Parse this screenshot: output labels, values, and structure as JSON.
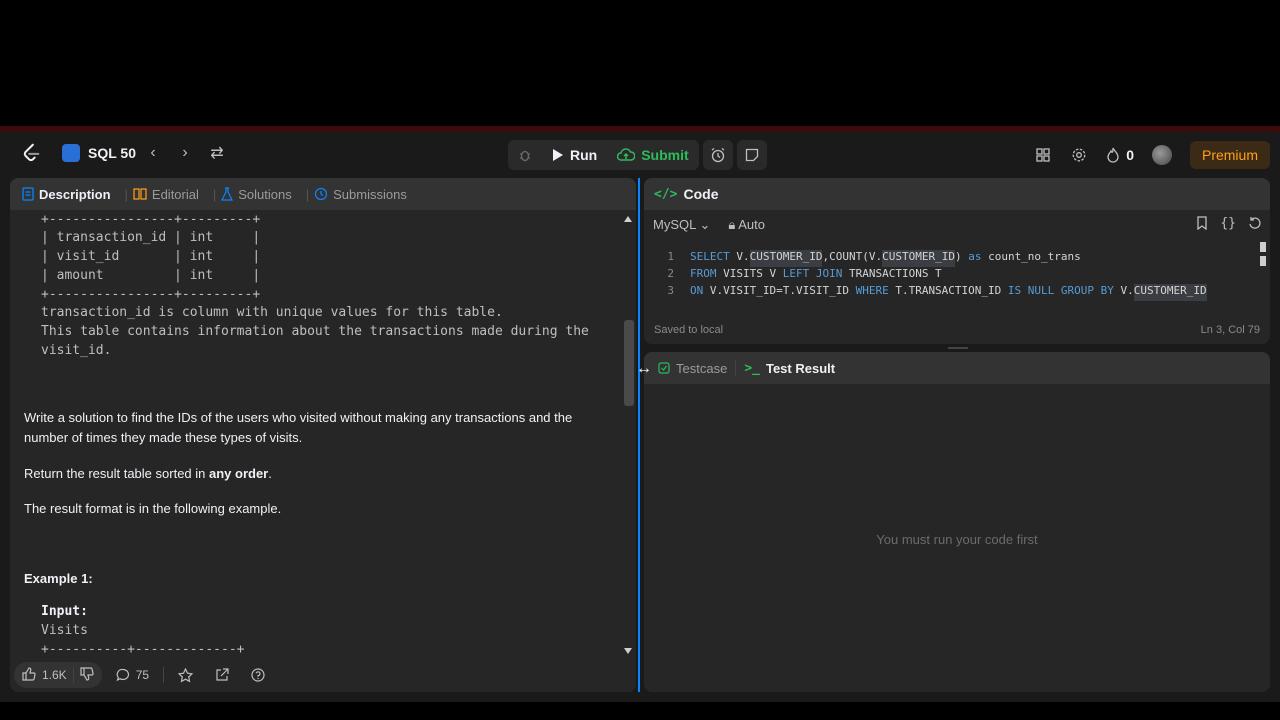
{
  "nav": {
    "brand": "SQL 50",
    "run_label": "Run",
    "submit_label": "Submit",
    "streak_count": "0",
    "premium_label": "Premium"
  },
  "left_tabs": [
    {
      "label": "Description"
    },
    {
      "label": "Editorial"
    },
    {
      "label": "Solutions"
    },
    {
      "label": "Submissions"
    }
  ],
  "description": {
    "table_lines": [
      "+----------------+---------+",
      "| transaction_id | int     |",
      "| visit_id       | int     |",
      "| amount         | int     |",
      "+----------------+---------+"
    ],
    "note_lines": [
      "transaction_id is column with unique values for this table.",
      "This table contains information about the transactions made during the",
      "visit_id."
    ],
    "paragraph1": "Write a solution to find the IDs of the users who visited without making any transactions and the number of times they made these types of visits.",
    "paragraph2_pre": "Return the result table sorted in ",
    "paragraph2_bold": "any order",
    "paragraph2_post": ".",
    "paragraph3": "The result format is in the following example.",
    "example_title": "Example 1:",
    "input_label": "Input:",
    "input_table": "Visits",
    "input_border": "+----------+-------------+"
  },
  "footer": {
    "likes": "1.6K",
    "comments": "75"
  },
  "code": {
    "title": "Code",
    "language": "MySQL",
    "mode": "Auto",
    "status": "Saved to local",
    "position": "Ln 3, Col 79",
    "lines": [
      {
        "n": "1"
      },
      {
        "n": "2"
      },
      {
        "n": "3"
      }
    ]
  },
  "result": {
    "tab_testcase": "Testcase",
    "tab_result": "Test Result",
    "empty": "You must run your code first"
  },
  "colors": {
    "accent": "#0a84ff",
    "submit": "#2cbb5d",
    "premium": "#ffa116"
  }
}
